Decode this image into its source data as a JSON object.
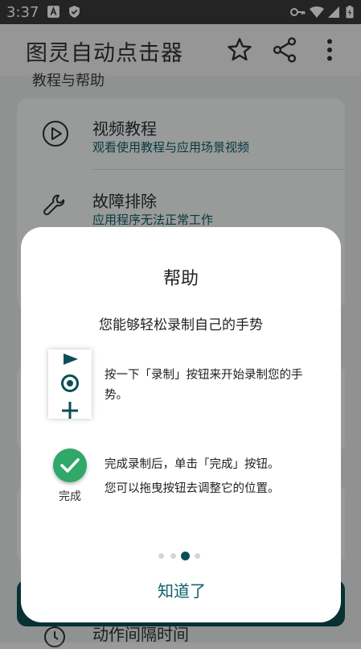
{
  "status_bar": {
    "time": "3:37"
  },
  "app_bar": {
    "title": "图灵自动点击器"
  },
  "background": {
    "section_label": "教程与帮助",
    "items": [
      {
        "title": "视频教程",
        "subtitle": "观看使用教程与应用场景视频"
      },
      {
        "title": "故障排除",
        "subtitle": "应用程序无法正常工作"
      }
    ],
    "bottom_item": "动作间隔时间"
  },
  "dialog": {
    "title": "帮助",
    "subtitle": "您能够轻松录制自己的手势",
    "step1": "按一下「录制」按钮来开始录制您的手势。",
    "done_label": "完成",
    "step2_line1": "完成录制后，单击「完成」按钮。",
    "step2_line2": "您可以拖曳按钮去调整它的位置。",
    "page_indicator": {
      "total": 4,
      "active": 3
    },
    "ok_button": "知道了"
  },
  "colors": {
    "accent": "#0b4f56",
    "done_green": "#2fa86a",
    "link_teal": "#0d5f6a"
  }
}
